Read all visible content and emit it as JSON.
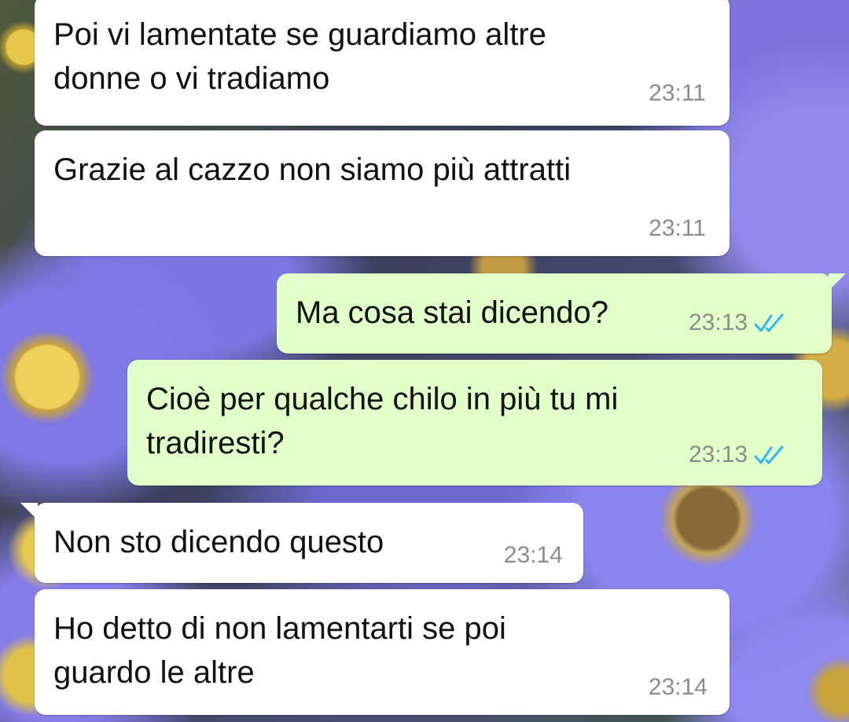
{
  "messages": [
    {
      "direction": "in",
      "text": "Poi vi lamentate se guardiamo altre\ndonne o vi tradiamo",
      "time": "23:11"
    },
    {
      "direction": "in",
      "text": "Grazie al cazzo non siamo più attratti",
      "time": "23:11"
    },
    {
      "direction": "out",
      "text": "Ma cosa stai dicendo?",
      "time": "23:13",
      "status": "read",
      "status_icon": "double-check-icon"
    },
    {
      "direction": "out",
      "text": "Cioè per qualche chilo in più tu mi\ntradiresti?",
      "time": "23:13",
      "status": "read",
      "status_icon": "double-check-icon"
    },
    {
      "direction": "in",
      "text": "Non sto dicendo questo",
      "time": "23:14"
    },
    {
      "direction": "in",
      "text": "Ho detto di non lamentarti se poi\nguardo le altre",
      "time": "23:14"
    }
  ],
  "colors": {
    "incoming_bubble": "#ffffff",
    "outgoing_bubble": "#e2fec9",
    "read_ticks": "#34b7f1",
    "time_text": "#8c8c8c"
  }
}
